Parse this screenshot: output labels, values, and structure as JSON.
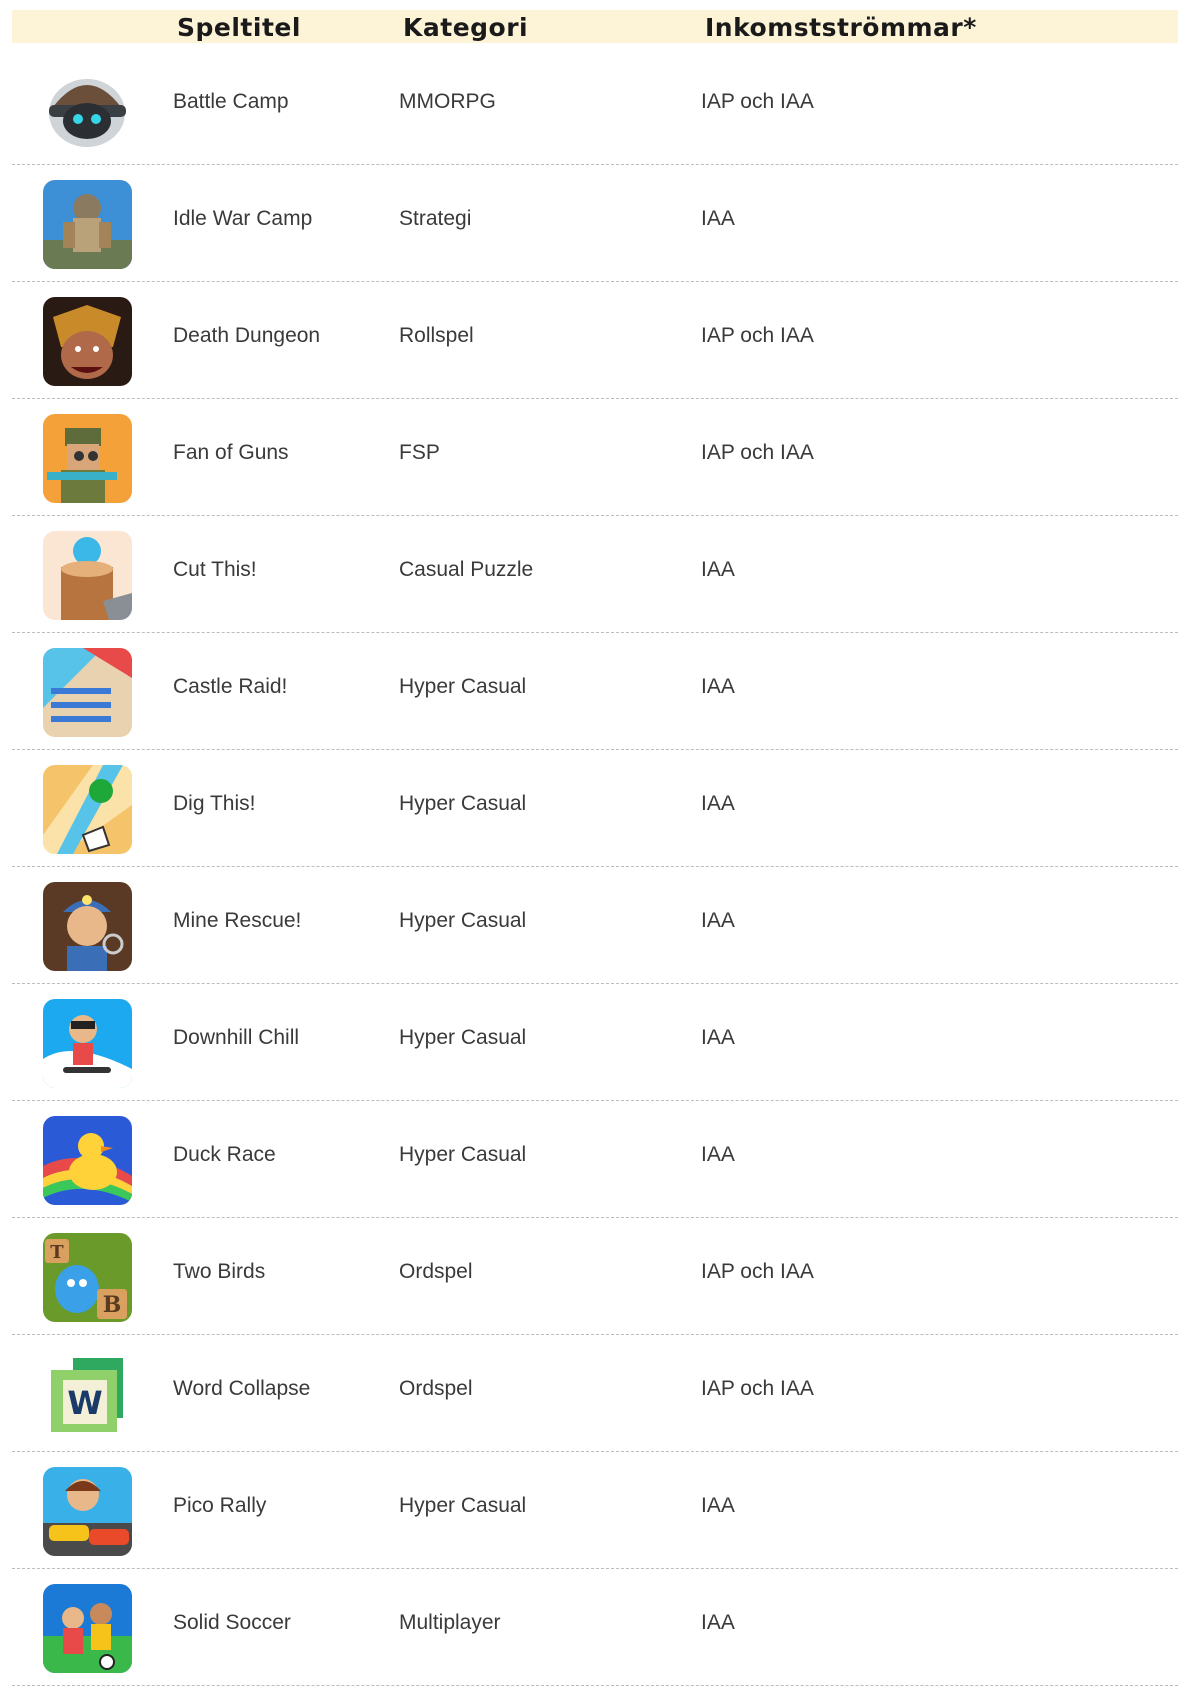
{
  "table": {
    "headers": [
      "Speltitel",
      "Kategori",
      "Inkomstströmmar*"
    ],
    "rows": [
      {
        "title": "Battle Camp",
        "category": "MMORPG",
        "revenue": "IAP och IAA",
        "icon": "battle-camp-icon"
      },
      {
        "title": "Idle War Camp",
        "category": "Strategi",
        "revenue": "IAA",
        "icon": "idle-war-camp-icon"
      },
      {
        "title": "Death Dungeon",
        "category": "Rollspel",
        "revenue": "IAP och IAA",
        "icon": "death-dungeon-icon"
      },
      {
        "title": "Fan of Guns",
        "category": "FSP",
        "revenue": "IAP och IAA",
        "icon": "fan-of-guns-icon"
      },
      {
        "title": "Cut This!",
        "category": "Casual Puzzle",
        "revenue": "IAA",
        "icon": "cut-this-icon"
      },
      {
        "title": "Castle Raid!",
        "category": "Hyper Casual",
        "revenue": "IAA",
        "icon": "castle-raid-icon"
      },
      {
        "title": "Dig This!",
        "category": "Hyper Casual",
        "revenue": "IAA",
        "icon": "dig-this-icon"
      },
      {
        "title": "Mine Rescue!",
        "category": "Hyper Casual",
        "revenue": "IAA",
        "icon": "mine-rescue-icon"
      },
      {
        "title": "Downhill Chill",
        "category": "Hyper Casual",
        "revenue": "IAA",
        "icon": "downhill-chill-icon"
      },
      {
        "title": "Duck Race",
        "category": "Hyper Casual",
        "revenue": "IAA",
        "icon": "duck-race-icon"
      },
      {
        "title": "Two Birds",
        "category": "Ordspel",
        "revenue": "IAP och IAA",
        "icon": "two-birds-icon"
      },
      {
        "title": "Word Collapse",
        "category": "Ordspel",
        "revenue": "IAP och IAA",
        "icon": "word-collapse-icon"
      },
      {
        "title": "Pico Rally",
        "category": "Hyper Casual",
        "revenue": "IAA",
        "icon": "pico-rally-icon"
      },
      {
        "title": "Solid Soccer",
        "category": "Multiplayer",
        "revenue": "IAA",
        "icon": "solid-soccer-icon"
      }
    ]
  },
  "word_collapse_letter": "W",
  "two_birds_letters": [
    "T",
    "B"
  ],
  "colors": {
    "header_bg": "#fdf3d6",
    "divider": "#bdbdbd",
    "text": "#3a3a3a"
  }
}
